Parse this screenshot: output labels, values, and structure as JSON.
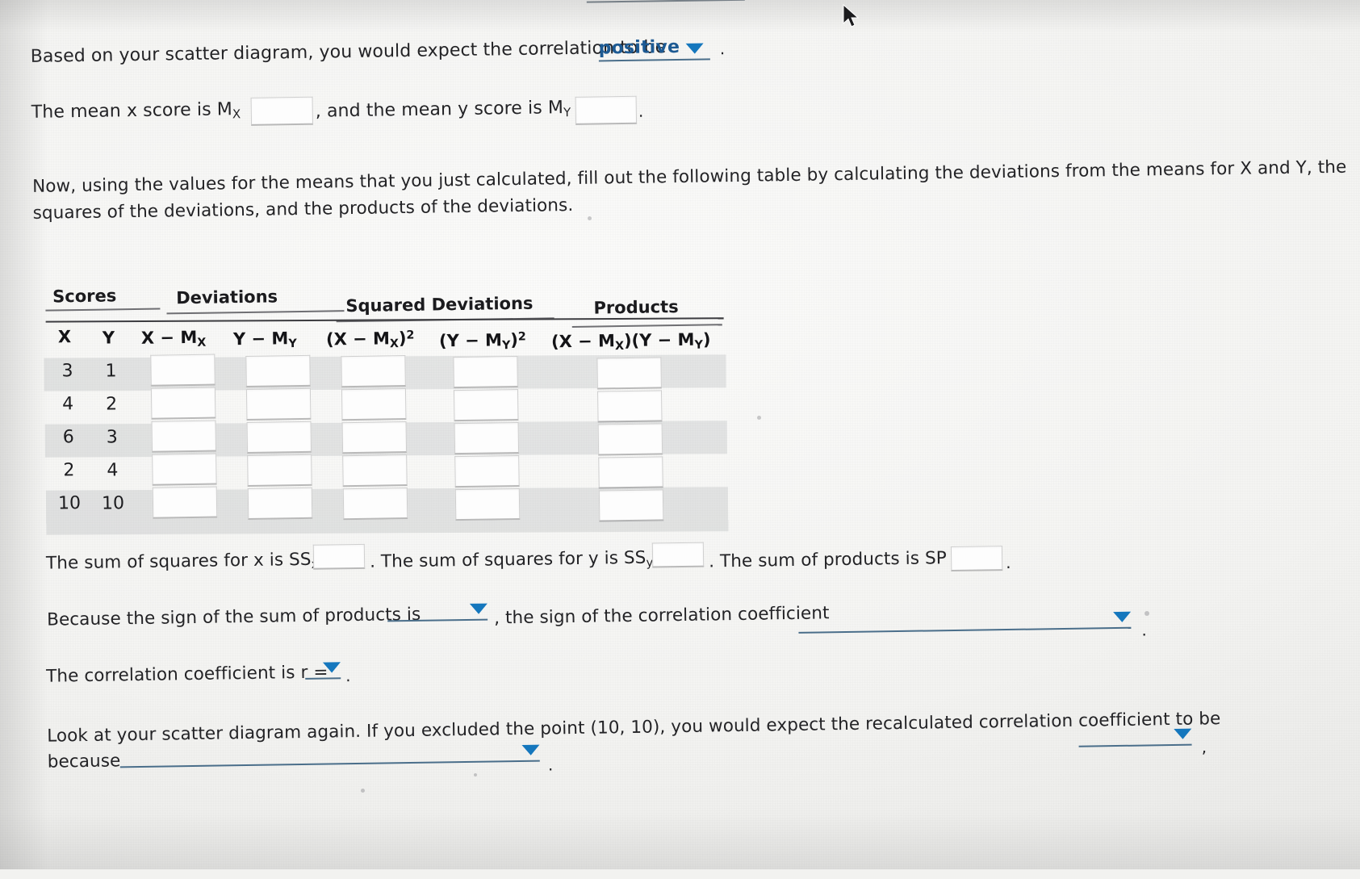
{
  "page": {
    "kind": "statistics-worksheet-photo"
  },
  "q1": {
    "text_before": "Based on your scatter diagram, you would expect the correlation to be",
    "dropdown_value": "positive",
    "text_after": "."
  },
  "q2": {
    "text_before": "The mean x score is M",
    "sub_x": "X",
    "equals": "=",
    "mid_text": ", and the mean y score is M",
    "sub_y": "Y",
    "equals2": "=",
    "mx_value": "",
    "my_value": "",
    "period": "."
  },
  "instructions": {
    "line1": "Now, using the values for the means that you just calculated, fill out the following table by calculating the deviations from the means for X and Y, the",
    "line2": "squares of the deviations, and the products of the deviations."
  },
  "table": {
    "group_headers": [
      "Scores",
      "Deviations",
      "Squared Deviations",
      "Products"
    ],
    "column_headers": [
      "X",
      "Y",
      "X − M",
      "Y − M",
      "(X − M",
      "(Y − M",
      "(X − M"
    ],
    "column_headers_full": [
      "X",
      "Y",
      "X − MX",
      "Y − MY",
      "(X − MX)²",
      "(Y − MY)²",
      "(X − MX)(Y − MY)"
    ],
    "rows": [
      {
        "x": "3",
        "y": "1",
        "dev_x": "",
        "dev_y": "",
        "sq_x": "",
        "sq_y": "",
        "prod": ""
      },
      {
        "x": "4",
        "y": "2",
        "dev_x": "",
        "dev_y": "",
        "sq_x": "",
        "sq_y": "",
        "prod": ""
      },
      {
        "x": "6",
        "y": "3",
        "dev_x": "",
        "dev_y": "",
        "sq_x": "",
        "sq_y": "",
        "prod": ""
      },
      {
        "x": "2",
        "y": "4",
        "dev_x": "",
        "dev_y": "",
        "sq_x": "",
        "sq_y": "",
        "prod": ""
      },
      {
        "x": "10",
        "y": "10",
        "dev_x": "",
        "dev_y": "",
        "sq_x": "",
        "sq_y": "",
        "prod": ""
      }
    ]
  },
  "sums": {
    "ssx_text_a": "The sum of squares for x is SS",
    "ssx_sub": "x",
    "ssx_eq": "=",
    "ssx_value": "",
    "ssy_text_a": ". The sum of squares for y is SS",
    "ssy_sub": "y",
    "ssy_eq": "=",
    "ssy_value": "",
    "sp_text_a": ". The sum of products is SP =",
    "sp_value": "",
    "sp_period": "."
  },
  "sign_sentence": {
    "part1": "Because the sign of the sum of products is",
    "dropdown1_value": "",
    "part2": ", the sign of the correlation coefficient",
    "dropdown2_value": "",
    "period": "."
  },
  "r_sentence": {
    "label": "The correlation coefficient is r =",
    "dropdown_value": "",
    "period": "."
  },
  "exclude_sentence": {
    "line1": "Look at your scatter diagram again. If you excluded the point (10, 10), you would expect the recalculated correlation coefficient to be",
    "dropdown1_value": "",
    "comma": ",",
    "line2_label": "because",
    "dropdown2_value": "",
    "period": "."
  },
  "icons": {
    "caret": "chevron-down-icon",
    "pointer": "mouse-pointer-icon"
  },
  "colors": {
    "dropdown_text": "#1d5a93",
    "caret": "#1577bd",
    "underline": "#4a6e8a",
    "blank_line": "#5d7b92",
    "text": "#232326",
    "row_shade": "rgba(120,125,130,.17)"
  }
}
